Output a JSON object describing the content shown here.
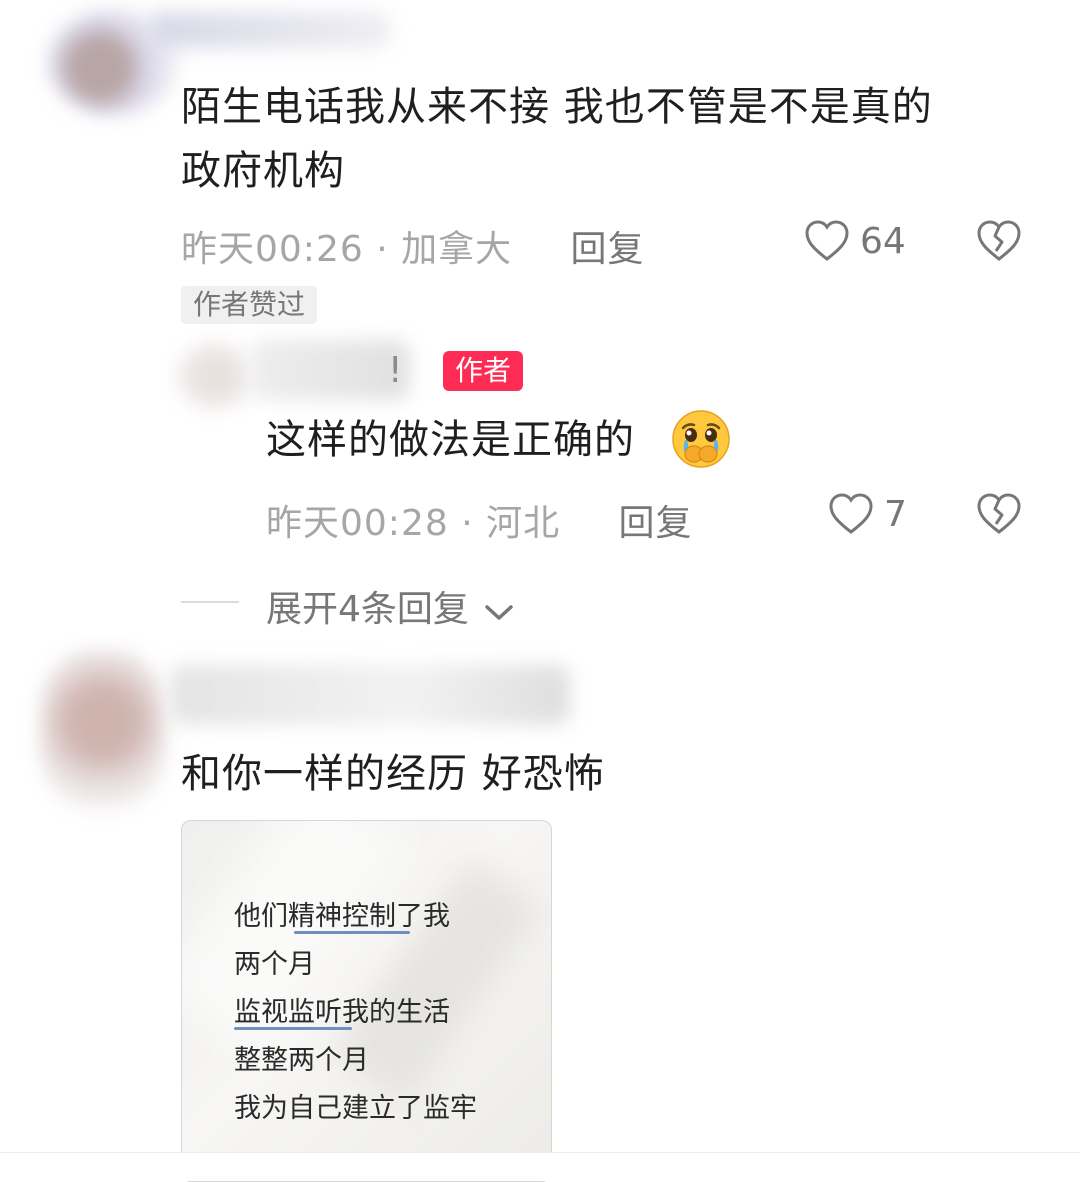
{
  "comments": [
    {
      "text_line1": "陌生电话我从来不接 我也不管是不是真的",
      "text_line2": "政府机构",
      "meta": "昨天00:26 · 加拿大",
      "reply_label": "回复",
      "likes": "64",
      "badge": "作者赞过"
    },
    {
      "partial_name": "!",
      "author_badge": "作者",
      "text": "这样的做法是正确的",
      "emoji": "pleading-crying-emoji",
      "meta": "昨天00:28 · 河北",
      "reply_label": "回复",
      "likes": "7"
    },
    {
      "text": "和你一样的经历 好恐怖",
      "image_lines": [
        "他们精神控制了我",
        "两个月",
        "监视监听我的生活",
        "整整两个月",
        "我为自己建立了监牢"
      ]
    }
  ],
  "expand_replies": "展开4条回复",
  "icons": {
    "like": "heart-outline-icon",
    "dislike": "broken-heart-icon",
    "expand": "chevron-down-icon"
  },
  "colors": {
    "author_badge": "#fe2c55",
    "meta_text": "#a6a6a6",
    "underline": "#6d8fc4"
  }
}
